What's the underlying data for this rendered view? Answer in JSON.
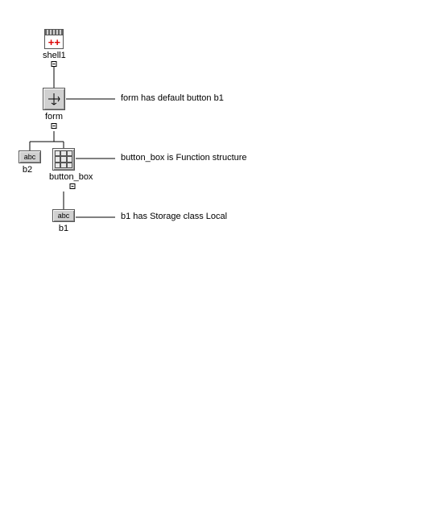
{
  "nodes": {
    "shell": {
      "label": "shell1"
    },
    "form": {
      "label": "form"
    },
    "b2": {
      "label": "b2",
      "icon_text": "abc"
    },
    "button_box": {
      "label": "button_box"
    },
    "b1": {
      "label": "b1",
      "icon_text": "abc"
    }
  },
  "annotations": {
    "form": "form has default button b1",
    "button_box": "button_box is Function structure",
    "b1": "b1 has Storage class Local"
  }
}
